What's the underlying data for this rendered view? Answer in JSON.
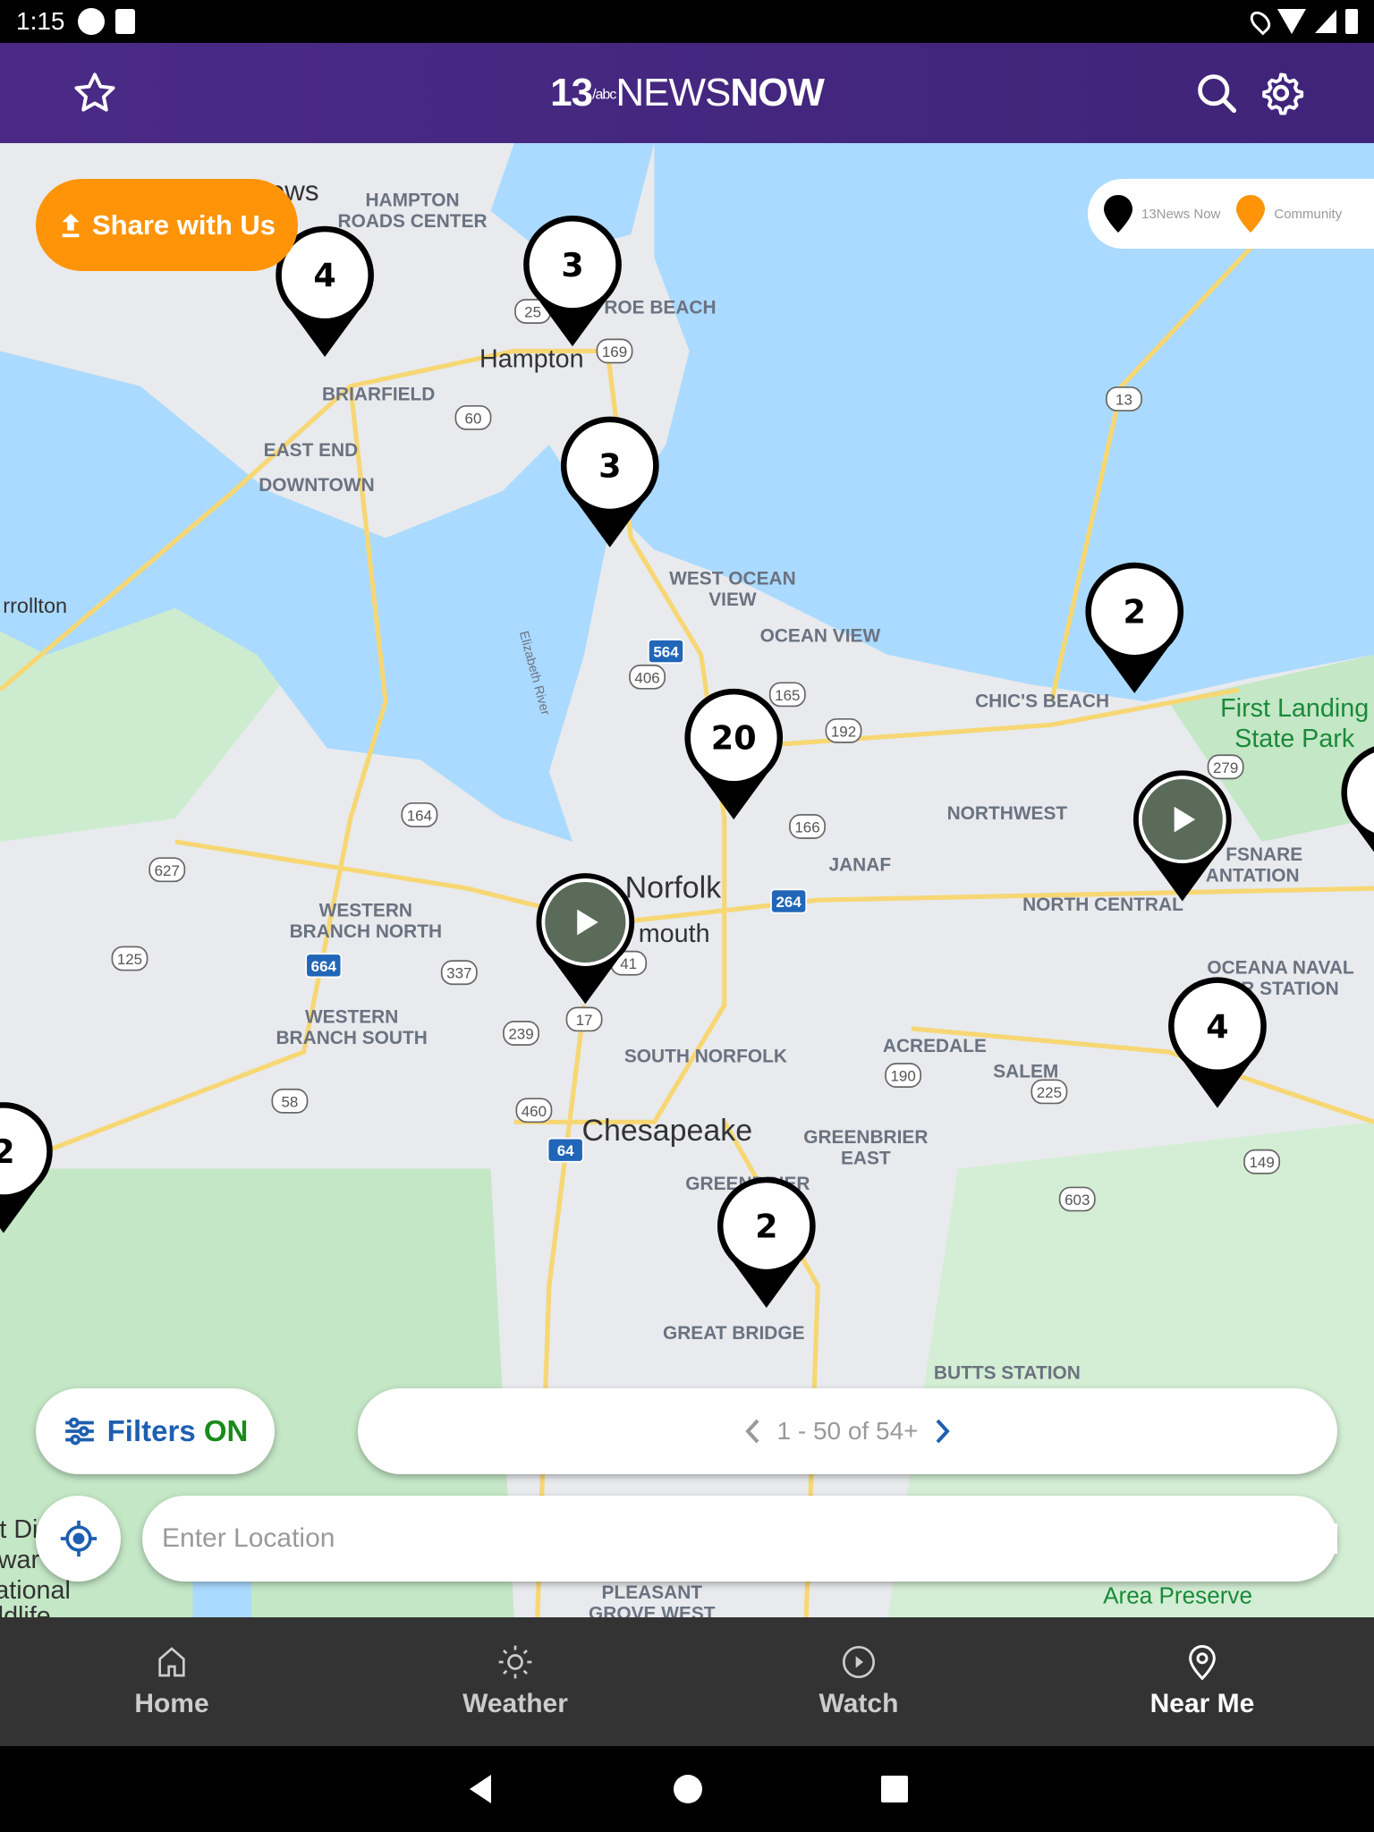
{
  "status_bar": {
    "time": "1:15"
  },
  "header": {
    "logo_number": "13",
    "logo_text_light": "NEWS",
    "logo_text_bold": "NOW"
  },
  "share_button": {
    "label": "Share with Us"
  },
  "legend": {
    "items": [
      {
        "label": "13News Now",
        "color": "#000000"
      },
      {
        "label": "Community",
        "color": "#ff9409"
      }
    ]
  },
  "map": {
    "labels": [
      {
        "text": "Newport News"
      },
      {
        "text": "HAMPTON"
      },
      {
        "text": "ROADS CENTER"
      },
      {
        "text": "Hampton"
      },
      {
        "text": "ROE BEACH"
      },
      {
        "text": "BRIARFIELD"
      },
      {
        "text": "EAST END"
      },
      {
        "text": "DOWNTOWN"
      },
      {
        "text": "rrollton"
      },
      {
        "text": "WEST OCEAN"
      },
      {
        "text": "VIEW"
      },
      {
        "text": "OCEAN VIEW"
      },
      {
        "text": "CHIC'S BEACH"
      },
      {
        "text": "First Landing"
      },
      {
        "text": "State Park"
      },
      {
        "text": "NORTHWEST"
      },
      {
        "text": "FSNARE"
      },
      {
        "text": "ANTATION"
      },
      {
        "text": "JANAF"
      },
      {
        "text": "Norfolk"
      },
      {
        "text": "mouth"
      },
      {
        "text": "NORTH CENTRAL"
      },
      {
        "text": "WESTERN"
      },
      {
        "text": "BRANCH NORTH"
      },
      {
        "text": "WESTERN"
      },
      {
        "text": "BRANCH SOUTH"
      },
      {
        "text": "SOUTH NORFOLK"
      },
      {
        "text": "ACREDALE"
      },
      {
        "text": "SALEM"
      },
      {
        "text": "OCEANA NAVAL"
      },
      {
        "text": "AIR STATION"
      },
      {
        "text": "Chesapeake"
      },
      {
        "text": "GREENBRIER"
      },
      {
        "text": "EAST"
      },
      {
        "text": "GREENBRIER"
      },
      {
        "text": "GREAT BRIDGE"
      },
      {
        "text": "BUTTS STATION"
      },
      {
        "text": "PLEASANT"
      },
      {
        "text": "GROVE WEST"
      },
      {
        "text": "Area Preserve"
      },
      {
        "text": "Elizabeth River"
      },
      {
        "text": "t Di"
      },
      {
        "text": "war"
      },
      {
        "text": "ational"
      },
      {
        "text": "ldlife..."
      }
    ],
    "shields": [
      "169",
      "60",
      "13",
      "564",
      "406",
      "165",
      "192",
      "279",
      "166",
      "164",
      "627",
      "264",
      "125",
      "664",
      "337",
      "17",
      "239",
      "190",
      "225",
      "58",
      "460",
      "64",
      "149",
      "603",
      "41",
      "25"
    ],
    "markers": [
      {
        "count": "4",
        "type": "cluster"
      },
      {
        "count": "3",
        "type": "cluster"
      },
      {
        "count": "3",
        "type": "cluster"
      },
      {
        "count": "2",
        "type": "cluster"
      },
      {
        "count": "20",
        "type": "cluster"
      },
      {
        "count": "",
        "type": "video"
      },
      {
        "count": "",
        "type": "video"
      },
      {
        "count": "4",
        "type": "cluster"
      },
      {
        "count": "2",
        "type": "cluster"
      },
      {
        "count": "2",
        "type": "cluster"
      },
      {
        "count": "",
        "type": "cluster"
      }
    ]
  },
  "filters": {
    "label": "Filters",
    "state": "ON"
  },
  "pager": {
    "text": "1 - 50 of 54+"
  },
  "location_input": {
    "placeholder": "Enter Location",
    "value": ""
  },
  "bottom_nav": {
    "items": [
      {
        "label": "Home"
      },
      {
        "label": "Weather"
      },
      {
        "label": "Watch"
      },
      {
        "label": "Near Me"
      }
    ],
    "active": "Near Me"
  }
}
